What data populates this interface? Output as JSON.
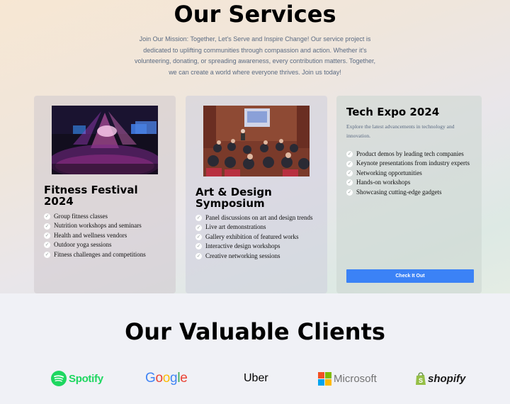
{
  "services": {
    "title": "Our Services",
    "description": "Join Our Mission: Together, Let's Serve and Inspire Change! Our service project is dedicated to uplifting communities through compassion and action. Whether it's volunteering, donating, or spreading awareness, every contribution matters. Together, we can create a world where everyone thrives. Join us today!",
    "cards": [
      {
        "title_line1": "Fitness Festival",
        "title_line2": "2024",
        "image": "concert-crowd-photo",
        "items": [
          "Group fitness classes",
          "Nutrition workshops and seminars",
          "Health and wellness vendors",
          "Outdoor yoga sessions",
          "Fitness challenges and competitions"
        ]
      },
      {
        "title_line1": "Art & Design",
        "title_line2": "Symposium",
        "image": "seminar-audience-photo",
        "items": [
          "Panel discussions on art and design trends",
          "Live art demonstrations",
          "Gallery exhibition of featured works",
          "Interactive design workshops",
          "Creative networking sessions"
        ]
      },
      {
        "title": "Tech Expo 2024",
        "description": "Explore the latest advancements in technology and innovation.",
        "items": [
          "Product demos by leading tech companies",
          "Keynote presentations from industry experts",
          "Networking opportunities",
          "Hands-on workshops",
          "Showcasing cutting-edge gadgets"
        ],
        "button_label": "Check It Out"
      }
    ],
    "check_icon": "check-circle-icon"
  },
  "clients": {
    "title": "Our Valuable Clients",
    "logos": [
      "Spotify",
      "Google",
      "Uber",
      "Microsoft",
      "shopify"
    ]
  },
  "colors": {
    "accent": "#3b82f6",
    "spotify": "#1ed760",
    "shopify": "#95bf47"
  }
}
